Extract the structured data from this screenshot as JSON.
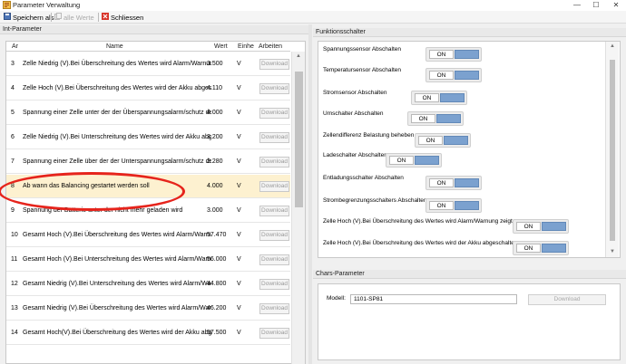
{
  "window": {
    "title": "Parameter Verwaltung",
    "minimize": "—",
    "maximize": "☐",
    "close": "✕"
  },
  "toolbar": {
    "save_as": "Speichern als",
    "all_values": "alle Werte",
    "close": "Schliessen"
  },
  "int_params": {
    "header": "Int-Parameter",
    "columns": {
      "nr": "Ar",
      "name": "Name",
      "value": "Wert",
      "unit": "Einhe",
      "actions": "Arbeiten"
    },
    "download_label": "Download",
    "rows": [
      {
        "nr": "3",
        "name": "Zelle Niedrig (V).Bei Überschreitung des Wertes wird Alarm/Warnung ausgelöst",
        "value": "3.500",
        "unit": "V"
      },
      {
        "nr": "4",
        "name": "Zelle Hoch (V).Bei Überschreitung des Wertes wird der Akku abgeschaltet",
        "value": "4.110",
        "unit": "V"
      },
      {
        "nr": "5",
        "name": "Spannung einer Zelle unter der der Überspannungsalarm/schutz deaktiviert wird",
        "value": "4.000",
        "unit": "V"
      },
      {
        "nr": "6",
        "name": "Zelle Niedrig (V).Bei Unterschreitung des Wertes wird der Akku abgeschaltet",
        "value": "3.200",
        "unit": "V"
      },
      {
        "nr": "7",
        "name": "Spannung einer Zelle über der der Unterspannungsalarm/schutz deaktiviert wird",
        "value": "3.280",
        "unit": "V"
      },
      {
        "nr": "8",
        "name": "Ab wann das Balancing gestartet werden soll",
        "value": "4.000",
        "unit": "V"
      },
      {
        "nr": "9",
        "name": "Spannung der Batterie unter der nicht mehr geladen wird",
        "value": "3.000",
        "unit": "V"
      },
      {
        "nr": "10",
        "name": "Gesamt Hoch (V).Bei Überschreitung des Wertes wird Alarm/Warnung ausgelöst",
        "value": "57.470",
        "unit": "V"
      },
      {
        "nr": "11",
        "name": "Gesamt Hoch (V).Bei Unterschreitung des Wertes wird Alarm/Warnung ausgelöst",
        "value": "56.000",
        "unit": "V"
      },
      {
        "nr": "12",
        "name": "Gesamt Niedrig (V).Bei Unterschreitung des Wertes wird Alarm/Warnung ausgelöst",
        "value": "44.800",
        "unit": "V"
      },
      {
        "nr": "13",
        "name": "Gesamt Niedrig (V).Bei Überschreitung des Wertes wird Alarm/Warnung ausgelöst",
        "value": "46.200",
        "unit": "V"
      },
      {
        "nr": "14",
        "name": "Gesamt Hoch(V).Bei Überschreitung des Wertes wird der Akku abgeschaltet",
        "value": "57.500",
        "unit": "V"
      }
    ]
  },
  "switches": {
    "header": "Funktionsschalter",
    "on_label": "ON",
    "items": [
      {
        "label": "Spannungssensor Abschalten"
      },
      {
        "label": "Temperatursensor Abschalten"
      },
      {
        "label": "Stromsensor Abschalten"
      },
      {
        "label": "Umschalter Abschalten"
      },
      {
        "label": "Zellendifferenz Belastung beheben"
      },
      {
        "label": "Ladeschalter Abschalten"
      },
      {
        "label": "Entladungsschalter Abschalten"
      },
      {
        "label": "Strombegrenzungsschalters Abschalten"
      },
      {
        "label": "Zelle Hoch (V).Bei Überschreitung des Wertes wird Alarm/Warnung zeigt"
      },
      {
        "label": "Zelle Hoch (V).Bei Überschreitung des Wertes wird der Akku abgeschalte."
      }
    ]
  },
  "chars": {
    "header": "Chars-Parameter",
    "model_label": "Modell:",
    "model_value": "1101-SP81",
    "download_label": "Download"
  },
  "colors": {
    "selected_row": "#fdf1d0",
    "highlight_ellipse": "#e6241c",
    "switch_knob": "#7ba1cf"
  }
}
